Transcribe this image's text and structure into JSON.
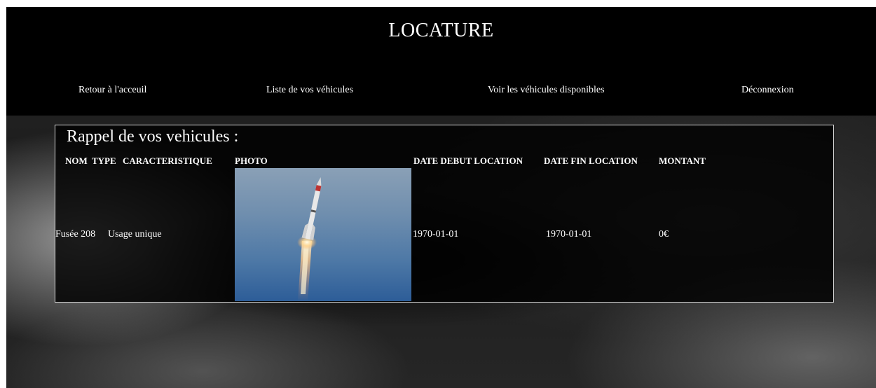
{
  "header": {
    "brand": "LOCATURE",
    "nav": [
      {
        "label": "Retour à l'acceuil"
      },
      {
        "label": "Liste de vos véhicules"
      },
      {
        "label": "Voir les véhicules disponibles"
      },
      {
        "label": "Déconnexion"
      }
    ]
  },
  "panel": {
    "title": "Rappel de vos vehicules :",
    "columns": [
      "NOM",
      "TYPE",
      "CARACTERISTIQUE",
      "PHOTO",
      "DATE DEBUT LOCATION",
      "DATE FIN LOCATION",
      "MONTANT"
    ],
    "rows": [
      {
        "name": "Fusée 208",
        "type": "Usage unique",
        "caracteristique": "",
        "photo_subject": "rocket-launch-photo",
        "date_debut": "1970-01-01",
        "date_fin": "1970-01-01",
        "montant": "0€"
      }
    ]
  },
  "colors": {
    "header_bg": "#000000",
    "text": "#ffffff",
    "panel_border": "#d8d8d8"
  }
}
